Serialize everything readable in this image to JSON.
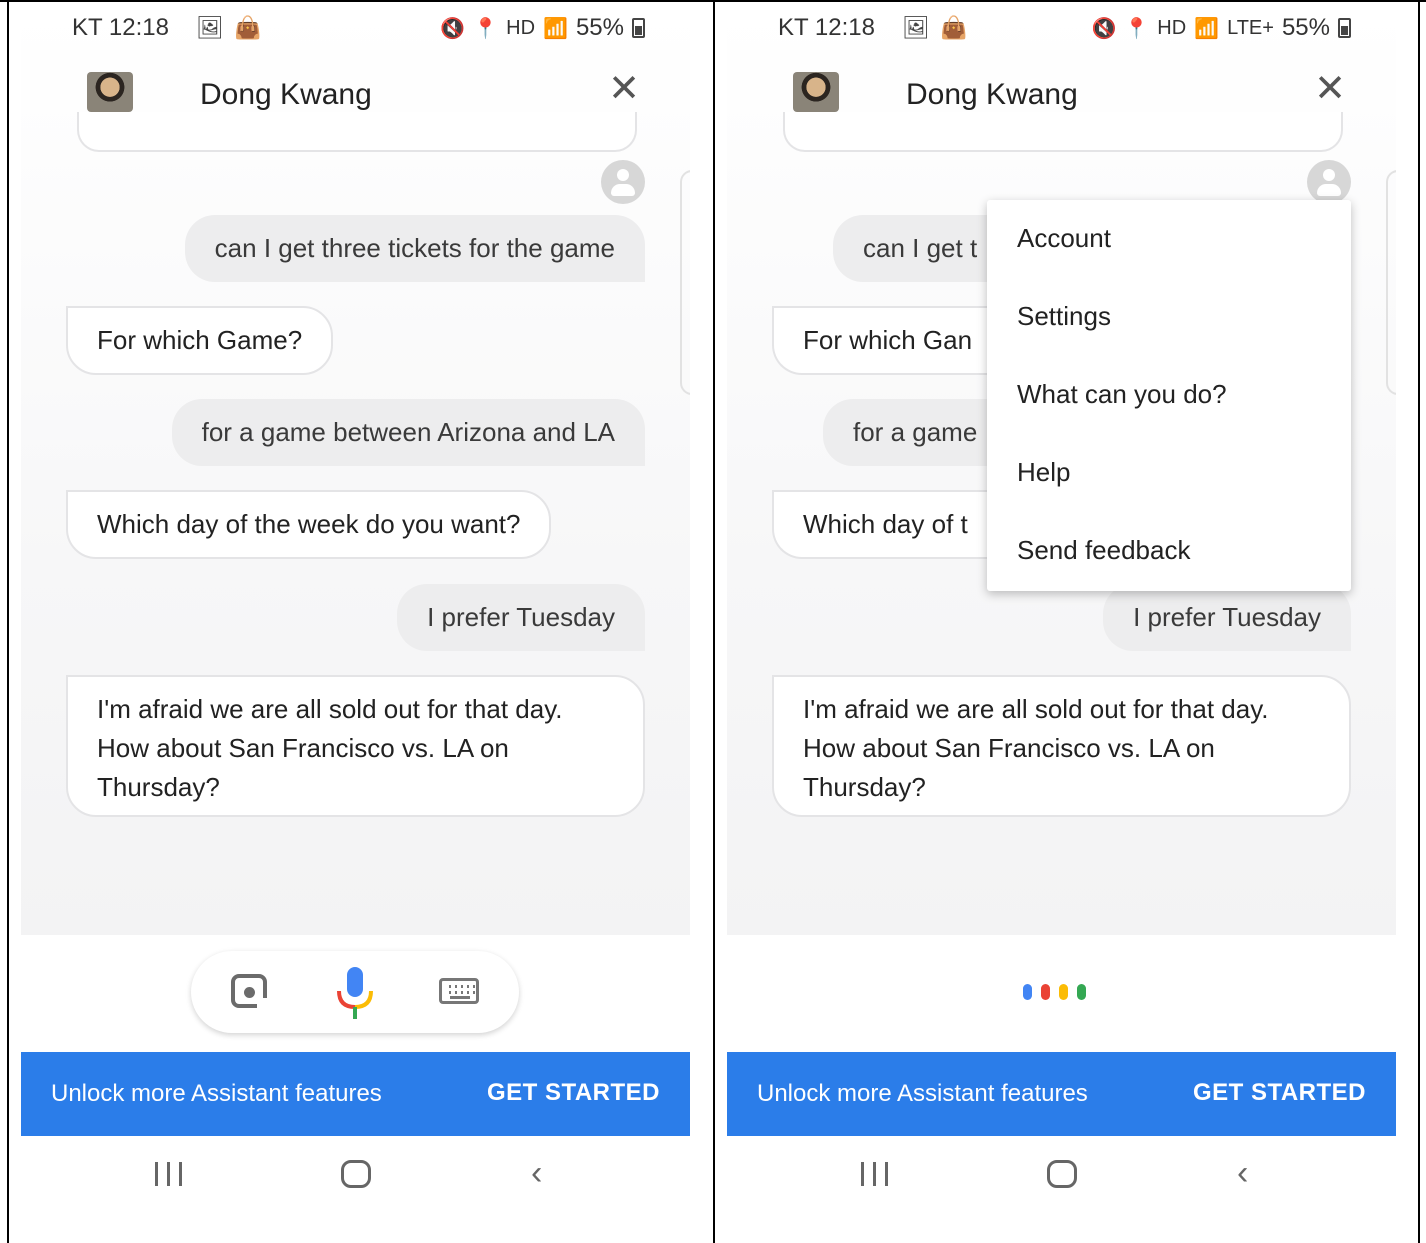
{
  "status_bar": {
    "time": "KT 12:18",
    "battery": "55%",
    "network_left": "",
    "network_right": "LTE+"
  },
  "header": {
    "contact_name": "Dong Kwang",
    "close_icon": "close-icon",
    "close_glyph": "✕"
  },
  "conversation": [
    {
      "role": "user",
      "text": "can I get three tickets for the game"
    },
    {
      "role": "assistant",
      "text": "For which Game?"
    },
    {
      "role": "user",
      "text": "for a game between Arizona and LA"
    },
    {
      "role": "assistant",
      "text": "Which day of the week do you want?"
    },
    {
      "role": "user",
      "text": "I prefer Tuesday"
    },
    {
      "role": "assistant",
      "text": "I'm afraid we are all sold out for that day. How about San Francisco vs. LA on Thursday?"
    }
  ],
  "right_truncated": {
    "b1": "can I get t",
    "b2": "For which Gan",
    "b3": "for a game",
    "b4": "Which day of t"
  },
  "menu": {
    "items": [
      "Account",
      "Settings",
      "What can you do?",
      "Help",
      "Send feedback"
    ]
  },
  "input_bar": {
    "icons": [
      "lens-icon",
      "mic-icon",
      "keyboard-icon"
    ]
  },
  "listening_dots": {
    "colors": [
      "#4285F4",
      "#EA4335",
      "#FBBC05",
      "#34A853"
    ]
  },
  "banner": {
    "text": "Unlock more Assistant features",
    "cta": "GET STARTED",
    "color": "#2b7de9"
  },
  "navbar": {
    "icons": [
      "recent-apps-icon",
      "home-icon",
      "back-icon"
    ],
    "back_glyph": "‹"
  }
}
